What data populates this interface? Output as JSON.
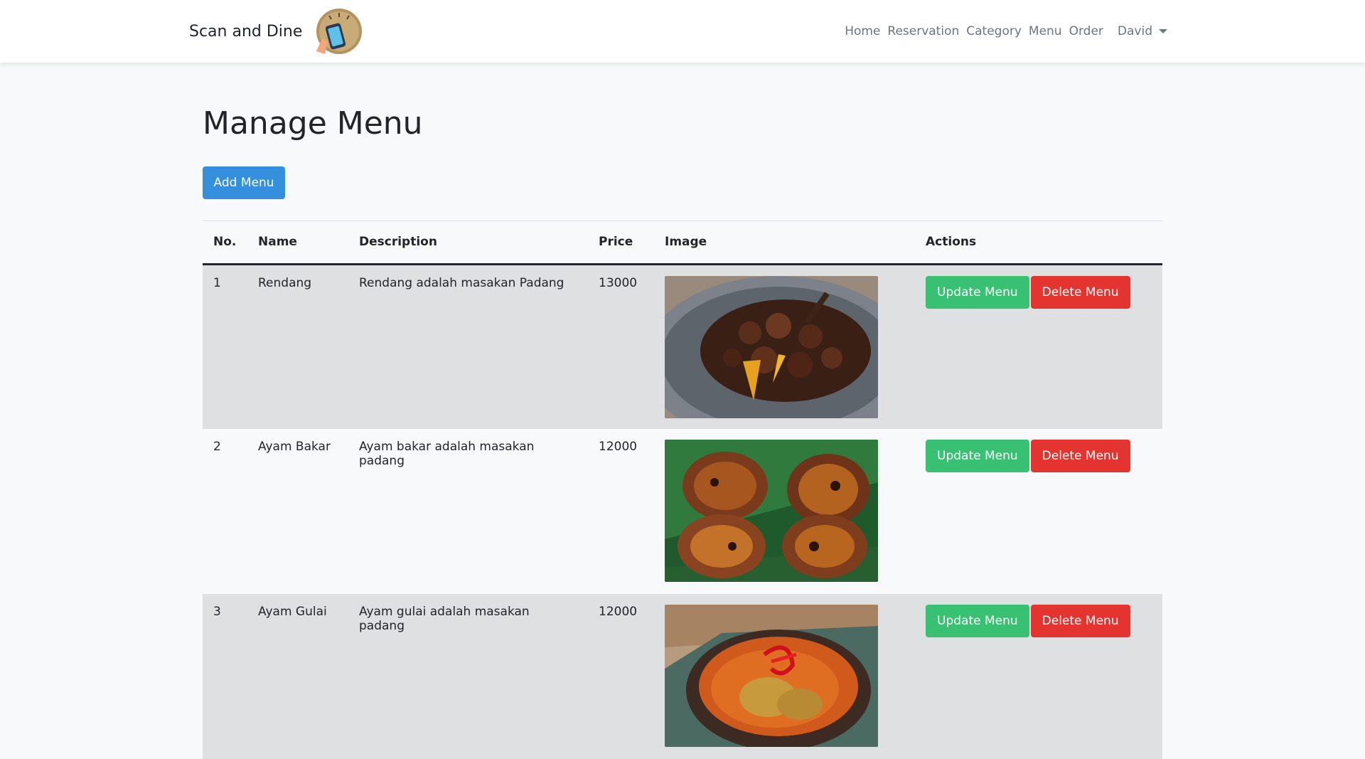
{
  "navbar": {
    "brand": "Scan and Dine",
    "links": [
      "Home",
      "Reservation",
      "Category",
      "Menu",
      "Order"
    ],
    "user": "David"
  },
  "page": {
    "title": "Manage Menu",
    "add_button": "Add Menu"
  },
  "table": {
    "headers": [
      "No.",
      "Name",
      "Description",
      "Price",
      "Image",
      "Actions"
    ],
    "rows": [
      {
        "no": "1",
        "name": "Rendang",
        "description": "Rendang adalah masakan Padang",
        "price": "13000"
      },
      {
        "no": "2",
        "name": "Ayam Bakar",
        "description": "Ayam bakar adalah masakan padang",
        "price": "12000"
      },
      {
        "no": "3",
        "name": "Ayam Gulai",
        "description": "Ayam gulai adalah masakan padang",
        "price": "12000"
      }
    ],
    "update_label": "Update Menu",
    "delete_label": "Delete Menu"
  },
  "colors": {
    "primary": "#3490dc",
    "success": "#38c172",
    "danger": "#e3342f"
  }
}
